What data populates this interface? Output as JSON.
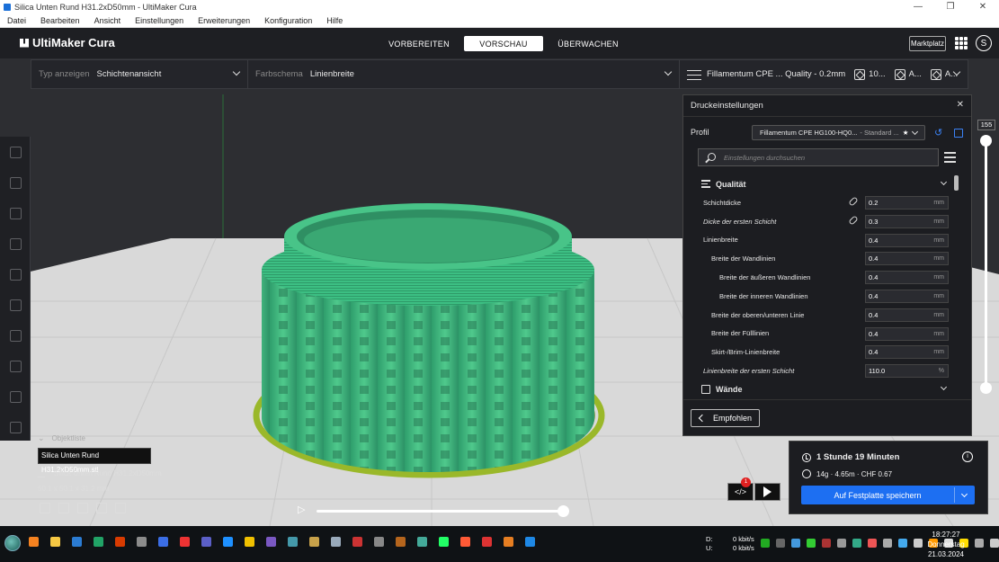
{
  "window": {
    "title": "Silica Unten Rund H31.2xD50mm - UltiMaker Cura",
    "controls": [
      "—",
      "❐",
      "✕"
    ]
  },
  "menubar": [
    "Datei",
    "Bearbeiten",
    "Ansicht",
    "Einstellungen",
    "Erweiterungen",
    "Konfiguration",
    "Hilfe"
  ],
  "header": {
    "brand": "UltiMaker Cura",
    "tabs": [
      {
        "label": "VORBEREITEN",
        "active": false
      },
      {
        "label": "VORSCHAU",
        "active": true
      },
      {
        "label": "ÜBERWACHEN",
        "active": false
      }
    ],
    "marketplace": "Marktplatz",
    "account_initial": "S"
  },
  "viewbar": {
    "view_type_label": "Typ anzeigen",
    "view_type_value": "Schichtenansicht",
    "color_scheme_label": "Farbschema",
    "color_scheme_value": "Linienbreite",
    "printer_summary": "Fillamentum CPE ... Quality - 0.2mm",
    "infill": "10...",
    "support": "A...",
    "adhesion": "A..."
  },
  "left_toolbar_icons": [
    "move-icon",
    "scale-icon",
    "rotate-icon",
    "mirror-icon",
    "per-model-settings-icon",
    "support-blocker-icon",
    "measure-icon",
    "paint-icon",
    "cylinder-icon",
    "tree-support-icon"
  ],
  "object_list": {
    "header": "Objektliste",
    "item": "Silica Unten Rund H31.2xD50mm.stl",
    "edit_name": "Silica Unten Rund H31.2xD50mm",
    "dimensions": "50.1 x 50.1 x 31.2 mm"
  },
  "layer_slider": {
    "max_layer": "155"
  },
  "settings_panel": {
    "title": "Druckeinstellungen",
    "profile_label": "Profil",
    "profile_name": "Fillamentum CPE HG100-HQ0...",
    "profile_suffix": "- Standard ...",
    "search_placeholder": "Einstellungen durchsuchen",
    "category_quality": "Qualität",
    "category_walls": "Wände",
    "rows": [
      {
        "name": "Schichtdicke",
        "value": "0.2",
        "unit": "mm",
        "indent": 0,
        "link": true,
        "italic": false
      },
      {
        "name": "Dicke der ersten Schicht",
        "value": "0.3",
        "unit": "mm",
        "indent": 0,
        "link": true,
        "italic": true
      },
      {
        "name": "Linienbreite",
        "value": "0.4",
        "unit": "mm",
        "indent": 0,
        "link": false,
        "italic": false
      },
      {
        "name": "Breite der Wandlinien",
        "value": "0.4",
        "unit": "mm",
        "indent": 1,
        "link": false,
        "italic": false
      },
      {
        "name": "Breite der äußeren Wandlinien",
        "value": "0.4",
        "unit": "mm",
        "indent": 2,
        "link": false,
        "italic": false
      },
      {
        "name": "Breite der inneren Wandlinien",
        "value": "0.4",
        "unit": "mm",
        "indent": 2,
        "link": false,
        "italic": false
      },
      {
        "name": "Breite der oberen/unteren Linie",
        "value": "0.4",
        "unit": "mm",
        "indent": 1,
        "link": false,
        "italic": false
      },
      {
        "name": "Breite der Fülllinien",
        "value": "0.4",
        "unit": "mm",
        "indent": 1,
        "link": false,
        "italic": false
      },
      {
        "name": "Skirt-/Brim-Linienbreite",
        "value": "0.4",
        "unit": "mm",
        "indent": 1,
        "link": false,
        "italic": false
      },
      {
        "name": "Linienbreite der ersten Schicht",
        "value": "110.0",
        "unit": "%",
        "indent": 0,
        "link": false,
        "italic": true
      }
    ],
    "recommended_button": "Empfohlen"
  },
  "action_panel": {
    "print_time": "1 Stunde 19 Minuten",
    "material": "14g · 4.65m · CHF 0.67",
    "save_button": "Auf Festplatte speichern",
    "notification_count": "1"
  },
  "taskbar": {
    "net_down_label": "D:",
    "net_down": "0 kbit/s",
    "net_up_label": "U:",
    "net_up": "0 kbit/s",
    "time": "18:27:27",
    "day": "Donnerstag",
    "date": "21.03.2024",
    "app_colors": [
      "#f58220",
      "#f6c944",
      "#2b7cd3",
      "#21a366",
      "#d83b01",
      "#8c8c8c",
      "#3b6ee6",
      "#e33",
      "#5b5fc7",
      "#1e90ff",
      "#f0c000",
      "#7a58c2",
      "#49a",
      "#c8a24a",
      "#9ab",
      "#c33",
      "#888",
      "#b5651d",
      "#4a9",
      "#2f6",
      "#ff5a36",
      "#d33",
      "#e67e22",
      "#1e88e5"
    ],
    "tray_colors": [
      "#2a2",
      "#666",
      "#49d",
      "#3c3",
      "#a33",
      "#999",
      "#3a8",
      "#e55",
      "#aaa",
      "#4ae",
      "#ccc",
      "#f90",
      "#ddd",
      "#fd0",
      "#aaa",
      "#ccc"
    ]
  }
}
